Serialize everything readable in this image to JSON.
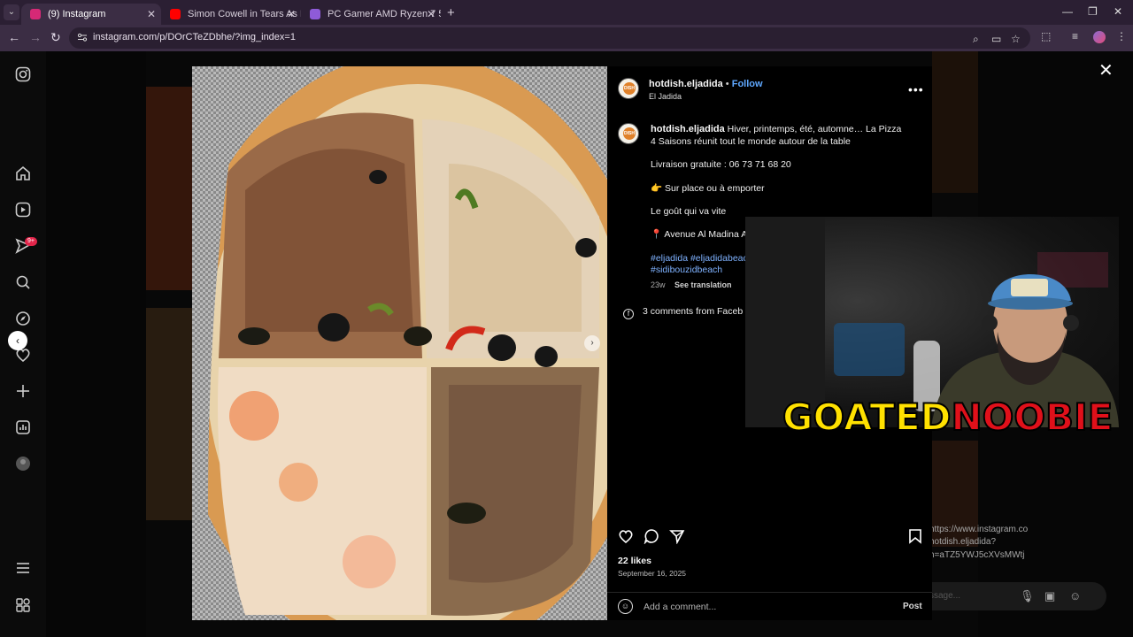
{
  "browser": {
    "tabs": [
      {
        "title": "(9) Instagram",
        "active": true,
        "favicon_color": "#d62976"
      },
      {
        "title": "Simon Cowell in Tears As Micha",
        "active": false,
        "favicon_color": "#ff0000"
      },
      {
        "title": "PC Gamer AMD Ryzen 7 5700X",
        "active": false,
        "favicon_color": "#8e5bd8"
      }
    ],
    "url": "instagram.com/p/DOrCTeZDbhe/?img_index=1"
  },
  "sidebar": {
    "notifications_badge": "9+",
    "icons": [
      "instagram-logo-icon",
      "home-icon",
      "reels-icon",
      "messages-icon",
      "search-icon",
      "explore-icon",
      "notifications-icon",
      "create-icon",
      "dashboard-icon",
      "profile-icon",
      "menu-icon",
      "more-apps-icon"
    ]
  },
  "post": {
    "username": "hotdish.eljadida",
    "follow_label": "Follow",
    "location": "El Jadida",
    "avatar_text": "DISH",
    "caption_user": "hotdish.eljadida",
    "caption_text": "Hiver, printemps, été, automne… La Pizza 4 Saisons réunit tout le monde autour de la table",
    "delivery": "Livraison gratuite : 06 73 71 68 20",
    "onsite": "👉 Sur place ou à emporter",
    "taste": "Le goût qui va vite",
    "address": "📍 Avenue Al Madina A",
    "hashtags_line1": "#eljadida #eljadidabeac",
    "hashtags_line2": "#sidibouzidbeach",
    "age": "23w",
    "see_translation": "See translation",
    "fb_comments": "3 comments from Faceb",
    "likes": "22 likes",
    "date": "September 16, 2025",
    "comment_placeholder": "Add a comment...",
    "post_label": "Post"
  },
  "stream_overlay": {
    "logo_part1": "GOATED",
    "logo_part2": "NOOBIE"
  },
  "background_text": {
    "link_line1": "https://www.instagram.co",
    "link_line2": "hotdish.eljadida?",
    "link_line3": "h=aTZ5YWJ5cXVsMWtj",
    "message_placeholder": "ssage..."
  },
  "colors": {
    "instagram_bg": "#000000",
    "link_blue": "#5fa8ff",
    "tab_active": "#3b2d44",
    "logo_yellow": "#ffe100",
    "logo_red": "#e0101a"
  }
}
